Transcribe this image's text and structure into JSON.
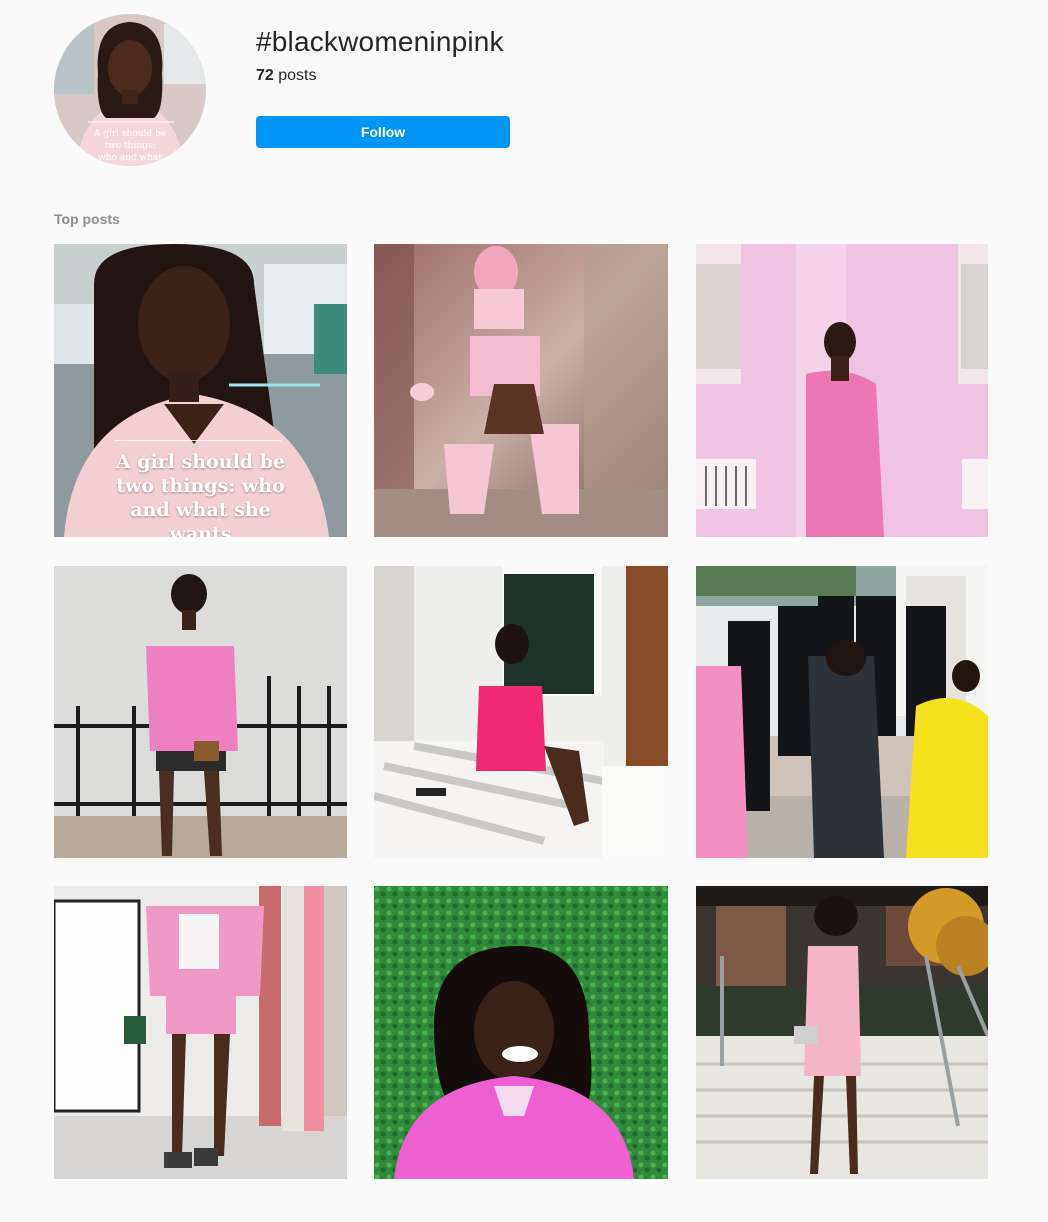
{
  "header": {
    "hashtag": "#blackwomeninpink",
    "post_count": "72",
    "post_count_suffix": " posts",
    "follow_label": "Follow"
  },
  "section": {
    "title": "Top posts"
  },
  "posts": [
    {
      "overlay_text": "A girl should be two things: who and what she wants"
    },
    {},
    {},
    {},
    {},
    {},
    {},
    {},
    {}
  ],
  "colors": {
    "follow_button": "#0095f6",
    "background": "#fafafa",
    "section_label": "#8e8e8e"
  }
}
